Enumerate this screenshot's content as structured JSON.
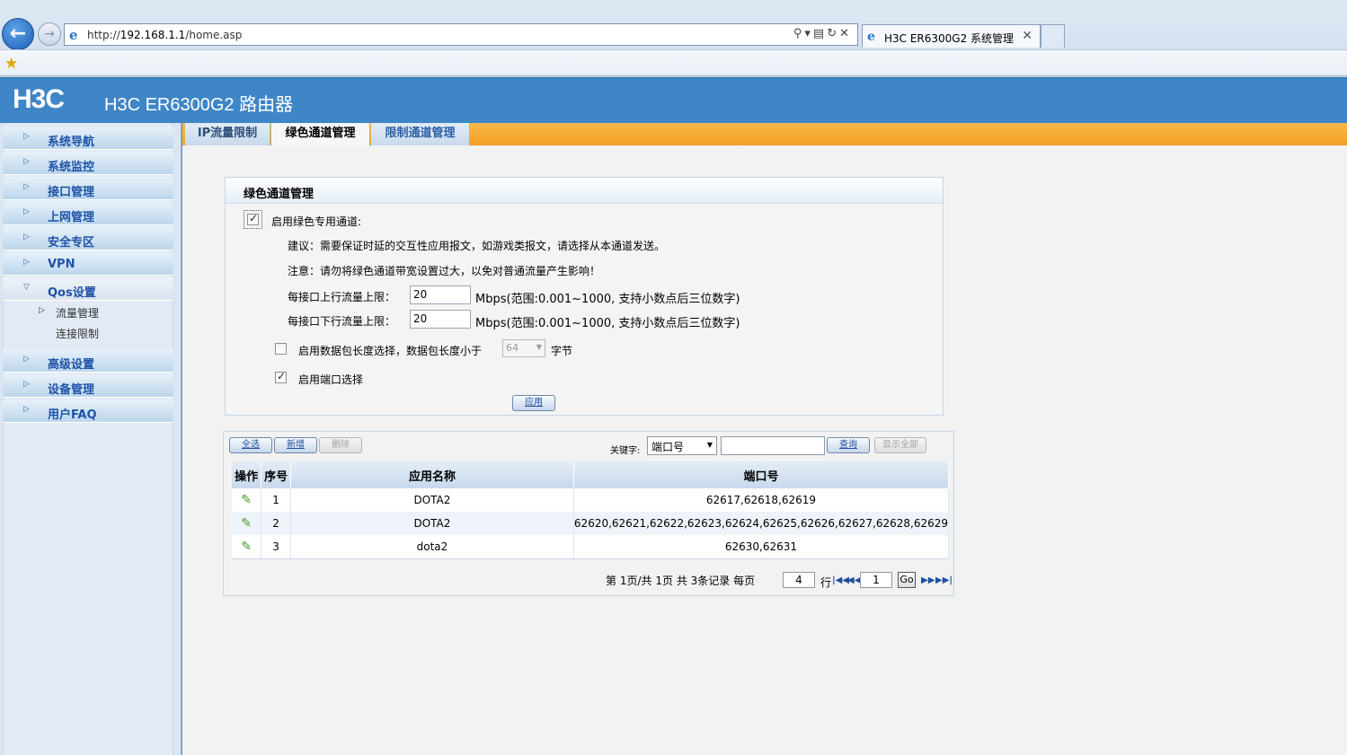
{
  "browser": {
    "url_prefix": "http://",
    "url_host": "192.168.1.1",
    "url_path": "/home.asp",
    "tab_title": "H3C ER6300G2 系统管理"
  },
  "header": {
    "logo": "H3C",
    "title": "H3C ER6300G2 路由器"
  },
  "sidebar": {
    "items": [
      {
        "label": "系统导航"
      },
      {
        "label": "系统监控"
      },
      {
        "label": "接口管理"
      },
      {
        "label": "上网管理"
      },
      {
        "label": "安全专区"
      },
      {
        "label": "VPN"
      },
      {
        "label": "Qos设置"
      },
      {
        "label": "高级设置"
      },
      {
        "label": "设备管理"
      },
      {
        "label": "用户FAQ"
      }
    ],
    "sub_items": [
      {
        "label": "流量管理"
      },
      {
        "label": "连接限制"
      }
    ]
  },
  "tabs": [
    {
      "label": "IP流量限制"
    },
    {
      "label": "绿色通道管理"
    },
    {
      "label": "限制通道管理"
    }
  ],
  "green": {
    "title": "绿色通道管理",
    "enable_label": "启用绿色专用通道:",
    "suggestion": "建议：需要保证时延的交互性应用报文，如游戏类报文，请选择从本通道发送。",
    "notice": "注意：请勿将绿色通道带宽设置过大，以免对普通流量产生影响！",
    "up_label": "每接口上行流量上限：",
    "up_value": "20",
    "down_label": "每接口下行流量上限：",
    "down_value": "20",
    "unit_hint": "Mbps(范围:0.001~1000, 支持小数点后三位数字)",
    "pkt_label": "启用数据包长度选择，数据包长度小于",
    "pkt_value": "64",
    "pkt_unit": "字节",
    "port_label": "启用端口选择",
    "apply": "应用"
  },
  "toolbar": {
    "select_all": "全选",
    "add": "新增",
    "delete": "删除",
    "keyword_label": "关键字:",
    "keyword_option": "端口号",
    "search": "查询",
    "show_all": "显示全部"
  },
  "table": {
    "headers": [
      "操作",
      "序号",
      "应用名称",
      "端口号"
    ],
    "rows": [
      {
        "no": "1",
        "app": "DOTA2",
        "ports": "62617,62618,62619"
      },
      {
        "no": "2",
        "app": "DOTA2",
        "ports": "62620,62621,62622,62623,62624,62625,62626,62627,62628,62629"
      },
      {
        "no": "3",
        "app": "dota2",
        "ports": "62630,62631"
      }
    ]
  },
  "pager": {
    "text_page": "第",
    "current": "1",
    "text_total": "页/共",
    "total_pages": "1",
    "text_pages": "页 共",
    "records": "3",
    "text_records": "条记录",
    "text_per": "每页",
    "per_page": "4",
    "text_rows": "行",
    "goto_value": "1",
    "go": "Go"
  }
}
